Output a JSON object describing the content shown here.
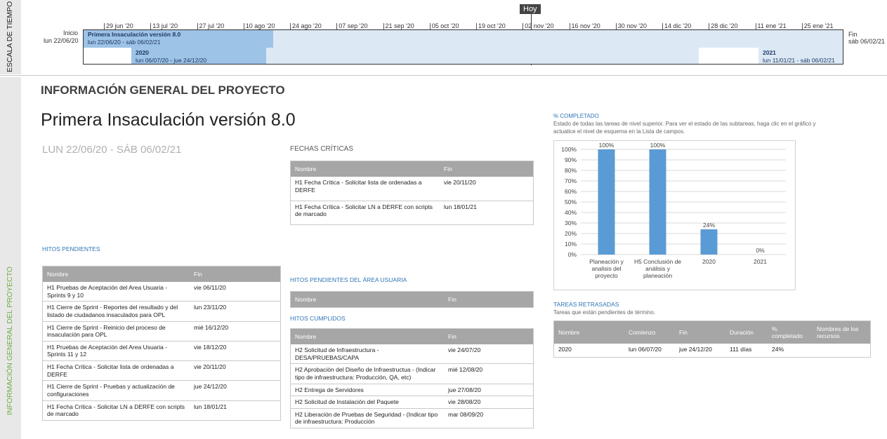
{
  "timeline": {
    "rail_label": "ESCALA DE TIEMPO",
    "today_label": "Hoy",
    "start_label": "Inicio",
    "start_date": "lun 22/06/20",
    "end_label": "Fin",
    "end_date": "sáb 06/02/21",
    "ticks": [
      "29 jun '20",
      "13 jul '20",
      "27 jul '20",
      "10 ago '20",
      "24 ago '20",
      "07 sep '20",
      "21 sep '20",
      "05 oct '20",
      "19 oct '20",
      "02 nov '20",
      "16 nov '20",
      "30 nov '20",
      "14 dic '20",
      "28 dic '20",
      "11 ene '21",
      "25 ene '21"
    ],
    "bars": [
      {
        "title": "Primera Insaculación versión 8.0",
        "dates": "lun 22/06/20 - sáb 06/02/21",
        "progress": 0.25
      },
      {
        "title": "2020",
        "dates": "lun 06/07/20 - jue 24/12/20"
      },
      {
        "title": "2021",
        "dates": "lun 11/01/21 - sáb 06/02/21"
      }
    ]
  },
  "report": {
    "rail_label": "INFORMACIÓN GENERAL DEL PROYECTO",
    "header": "INFORMACIÓN GENERAL DEL PROYECTO",
    "project_name": "Primera Insaculación versión 8.0",
    "project_dates": "LUN 22/06/20 -  SÁB 06/02/21",
    "critical": {
      "title": "FECHAS CRÍTICAS",
      "columns": [
        "Nombre",
        "Fin"
      ],
      "rows": [
        [
          "H1 Fecha Crítica - Solicitar lista de ordenadas a DERFE",
          "vie 20/11/20"
        ],
        [
          "H1 Fecha Crítica - Solicitar LN a DERFE con scripts de marcado",
          "lun 18/01/21"
        ]
      ]
    },
    "pending": {
      "title": "HITOS PENDIENTES",
      "columns": [
        "Nombre",
        "Fin"
      ],
      "rows": [
        [
          "H1 Pruebas de Aceptación del Area Usuaria - Sprints 9 y 10",
          "vie 06/11/20"
        ],
        [
          "H1 Cierre de Sprint - Reportes del resultado y del listado de ciudadanos insaculados para OPL",
          "lun 23/11/20"
        ],
        [
          "H1 Cierre de Sprint - Reinicio del proceso de insaculación para OPL",
          "mié 16/12/20"
        ],
        [
          "H1 Pruebas de Aceptación del Area Usuaria - Sprints 11 y 12",
          "vie 18/12/20"
        ],
        [
          "H1 Fecha Crítica - Solicitar lista de ordenadas a DERFE",
          "vie 20/11/20"
        ],
        [
          "H1 Cierre de Sprint - Pruebas y actualización de configuraciones",
          "jue 24/12/20"
        ],
        [
          "H1 Fecha Crítica - Solicitar LN a DERFE con scripts de marcado",
          "lun 18/01/21"
        ]
      ]
    },
    "user_area": {
      "title": "HITOS PENDIENTES DEL ÁREA USUARIA",
      "columns": [
        "Nombre",
        "Fin"
      ]
    },
    "completed": {
      "title": "HITOS CUMPLIDOS",
      "columns": [
        "Nombre",
        "Fin"
      ],
      "rows": [
        [
          "H2 Solicitud de Infraestructura - DESA/PRUEBAS/CAPA",
          "vie 24/07/20"
        ],
        [
          "H2 Aprobación del Diseño de Infraestructua - (Indicar tipo de infraestructura: Producción, QA, etc)",
          "mié 12/08/20"
        ],
        [
          "H2 Entrega de Servidores",
          "jue 27/08/20"
        ],
        [
          "H2 Solicitud de Instalación del Paquete",
          "vie 28/08/20"
        ],
        [
          "H2 Liberación de Pruebas de Seguridad - (Indicar tipo de infraestructura: Producción",
          "mar 08/09/20"
        ]
      ]
    },
    "percent": {
      "title": "% COMPLETADO",
      "description": "Estado de todas las tareas de nivel superior. Para ver el estado de las subtareas, haga clic en el gráfico y actualice el nivel de esquema en la Lista de campos."
    },
    "late": {
      "title": "TAREAS RETRASADAS",
      "description": "Tareas que están pendientes de término.",
      "columns": [
        "Nombre",
        "Comienzo",
        "Fin",
        "Duración",
        "% completado",
        "Nombres de los recursos"
      ],
      "rows": [
        [
          "2020",
          "lun 06/07/20",
          "jue 24/12/20",
          "111 días",
          "24%",
          ""
        ]
      ]
    }
  },
  "colors": {
    "bar": "#5b9bd5",
    "timeline_fill": "#dce9f5",
    "timeline_done": "#9dc3e6",
    "header_gray": "#a6a6a6",
    "accent": "#2e75b6",
    "green": "#70ad47"
  },
  "chart_data": {
    "type": "bar",
    "categories": [
      "Planeación y analisis del proyecto",
      "H5 Conclusión de análisis y planeación",
      "2020",
      "2021"
    ],
    "category_lines": [
      [
        "Planeación y",
        "analisis del",
        "proyecto"
      ],
      [
        "H5 Conclusión de",
        "análisis y",
        "planeación"
      ],
      [
        "2020"
      ],
      [
        "2021"
      ]
    ],
    "values": [
      100,
      100,
      24,
      0
    ],
    "data_labels": [
      "100%",
      "100%",
      "24%",
      "0%"
    ],
    "yticks": [
      "0%",
      "10%",
      "20%",
      "30%",
      "40%",
      "50%",
      "60%",
      "70%",
      "80%",
      "90%",
      "100%"
    ],
    "ylim": [
      0,
      100
    ],
    "grid": true
  }
}
